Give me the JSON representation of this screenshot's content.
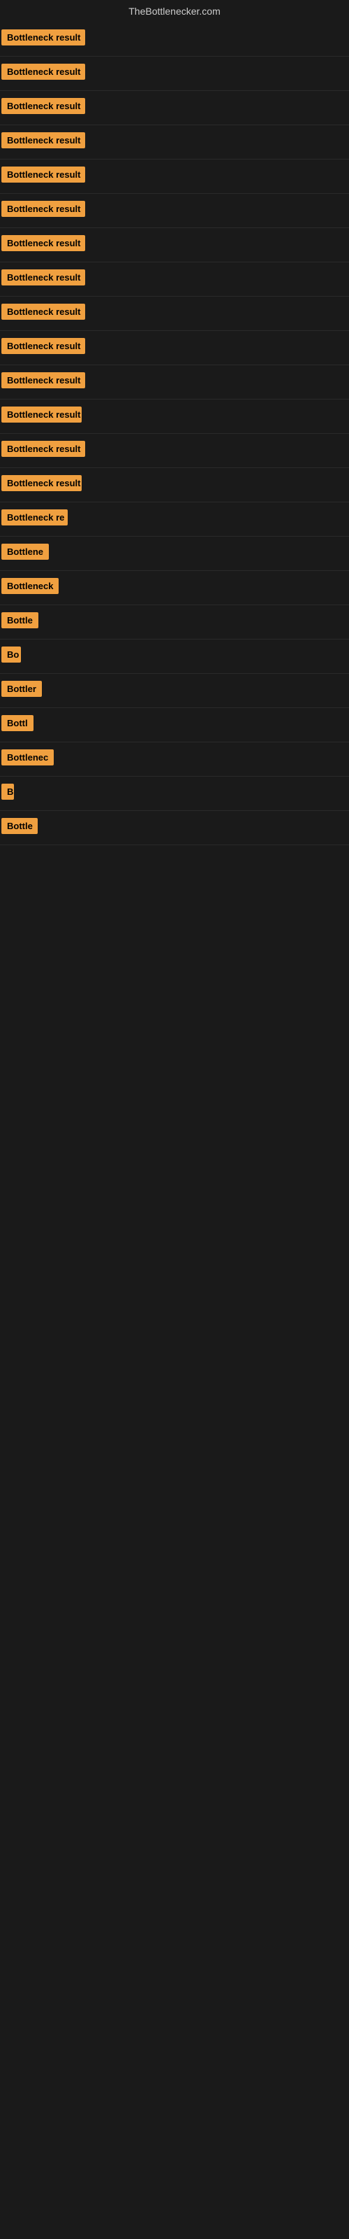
{
  "site": {
    "title": "TheBottlenecker.com"
  },
  "results": [
    {
      "label": "Bottleneck result",
      "width": 120
    },
    {
      "label": "Bottleneck result",
      "width": 120
    },
    {
      "label": "Bottleneck result",
      "width": 120
    },
    {
      "label": "Bottleneck result",
      "width": 120
    },
    {
      "label": "Bottleneck result",
      "width": 120
    },
    {
      "label": "Bottleneck result",
      "width": 120
    },
    {
      "label": "Bottleneck result",
      "width": 120
    },
    {
      "label": "Bottleneck result",
      "width": 120
    },
    {
      "label": "Bottleneck result",
      "width": 120
    },
    {
      "label": "Bottleneck result",
      "width": 120
    },
    {
      "label": "Bottleneck result",
      "width": 120
    },
    {
      "label": "Bottleneck result",
      "width": 115
    },
    {
      "label": "Bottleneck result",
      "width": 120
    },
    {
      "label": "Bottleneck result",
      "width": 115
    },
    {
      "label": "Bottleneck re",
      "width": 95
    },
    {
      "label": "Bottlene",
      "width": 75
    },
    {
      "label": "Bottleneck",
      "width": 82
    },
    {
      "label": "Bottle",
      "width": 58
    },
    {
      "label": "Bo",
      "width": 28
    },
    {
      "label": "Bottler",
      "width": 60
    },
    {
      "label": "Bottl",
      "width": 48
    },
    {
      "label": "Bottlenec",
      "width": 78
    },
    {
      "label": "B",
      "width": 18
    },
    {
      "label": "Bottle",
      "width": 52
    }
  ]
}
